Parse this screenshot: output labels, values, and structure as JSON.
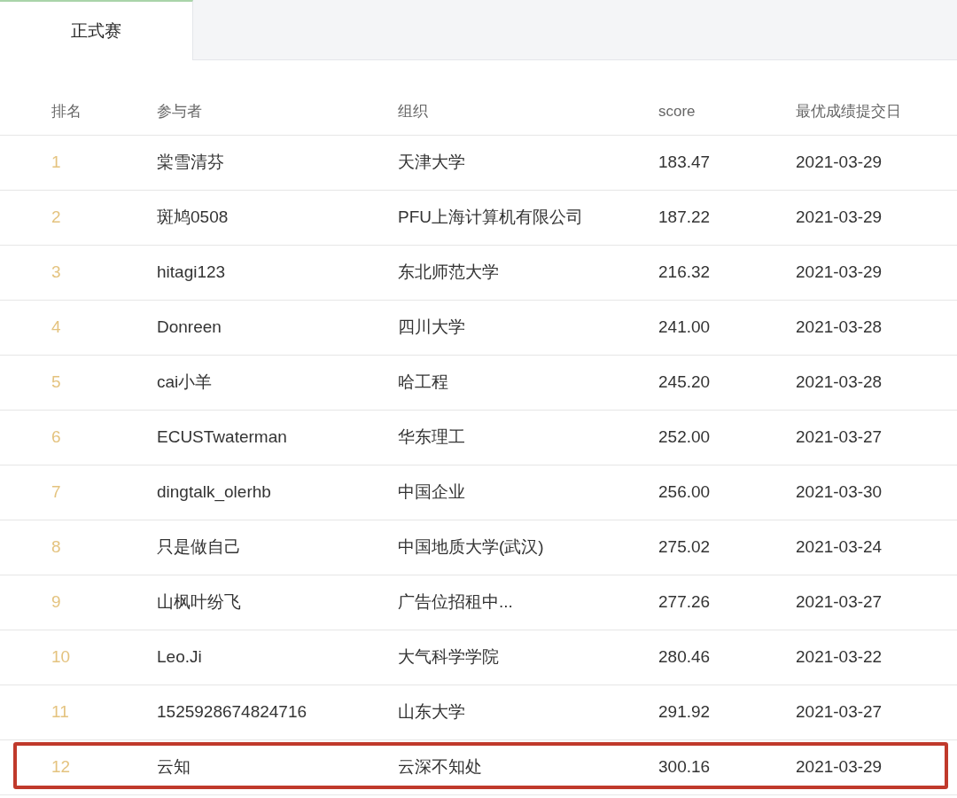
{
  "tabs": [
    {
      "label": "正式赛",
      "selected": true
    }
  ],
  "table": {
    "columns": [
      "排名",
      "参与者",
      "组织",
      "score",
      "最优成绩提交日"
    ],
    "rows": [
      {
        "rank": "1",
        "participant": "棠雪清芬",
        "organization": "天津大学",
        "score": "183.47",
        "date": "2021-03-29",
        "highlighted": false
      },
      {
        "rank": "2",
        "participant": "斑鸠0508",
        "organization": "PFU上海计算机有限公司",
        "score": "187.22",
        "date": "2021-03-29",
        "highlighted": false
      },
      {
        "rank": "3",
        "participant": "hitagi123",
        "organization": "东北师范大学",
        "score": "216.32",
        "date": "2021-03-29",
        "highlighted": false
      },
      {
        "rank": "4",
        "participant": "Donreen",
        "organization": "四川大学",
        "score": "241.00",
        "date": "2021-03-28",
        "highlighted": false
      },
      {
        "rank": "5",
        "participant": "cai小羊",
        "organization": "哈工程",
        "score": "245.20",
        "date": "2021-03-28",
        "highlighted": false
      },
      {
        "rank": "6",
        "participant": "ECUSTwaterman",
        "organization": "华东理工",
        "score": "252.00",
        "date": "2021-03-27",
        "highlighted": false
      },
      {
        "rank": "7",
        "participant": "dingtalk_olerhb",
        "organization": "中国企业",
        "score": "256.00",
        "date": "2021-03-30",
        "highlighted": false
      },
      {
        "rank": "8",
        "participant": "只是做自己",
        "organization": "中国地质大学(武汉)",
        "score": "275.02",
        "date": "2021-03-24",
        "highlighted": false
      },
      {
        "rank": "9",
        "participant": "山枫叶纷飞",
        "organization": "广告位招租中...",
        "score": "277.26",
        "date": "2021-03-27",
        "highlighted": false
      },
      {
        "rank": "10",
        "participant": "Leo.Ji",
        "organization": "大气科学学院",
        "score": "280.46",
        "date": "2021-03-22",
        "highlighted": false
      },
      {
        "rank": "11",
        "participant": "1525928674824716",
        "organization": "山东大学",
        "score": "291.92",
        "date": "2021-03-27",
        "highlighted": false
      },
      {
        "rank": "12",
        "participant": "云知",
        "organization": "云深不知处",
        "score": "300.16",
        "date": "2021-03-29",
        "highlighted": true
      }
    ]
  }
}
